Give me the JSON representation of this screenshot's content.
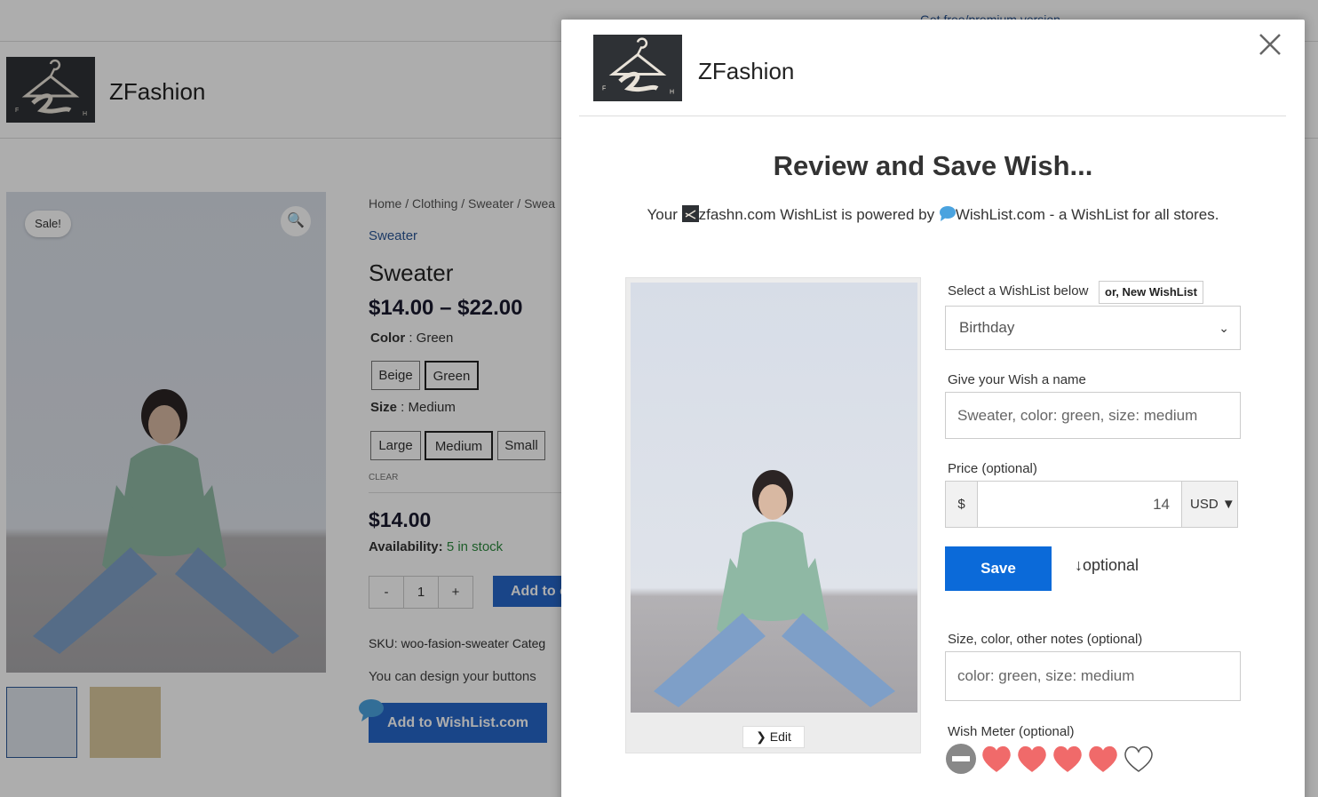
{
  "colors": {
    "accent": "#2666c9",
    "save": "#0b6ad9",
    "heart": "#f06a6a",
    "link": "#2b5797",
    "stock": "#2d8a3e"
  },
  "store": {
    "promo_link": "Get free/premium version",
    "site_name": "ZFashion",
    "sale_badge": "Sale!",
    "breadcrumb": "Home / Clothing / Sweater / Swea",
    "category_link": "Sweater",
    "product_title": "Sweater",
    "price_range": "$14.00 – $22.00",
    "color_label": "Color",
    "color_value": " : Green",
    "colors": [
      "Beige",
      "Green"
    ],
    "size_label": "Size",
    "size_value": " : Medium",
    "sizes": [
      "Large",
      "Medium",
      "Small"
    ],
    "clear": "CLEAR",
    "price_now": "$14.00",
    "availability_label": "Availability:",
    "availability_value": "5 in stock",
    "qty_minus": "-",
    "qty_value": "1",
    "qty_plus": "+",
    "add_to_cart": "Add to cart",
    "sku_line": "SKU: woo-fasion-sweater   Categ",
    "design_note": "You can design your buttons",
    "wishlist_button": "Add to WishList.com",
    "logo_letters": [
      "F",
      "H"
    ]
  },
  "modal": {
    "store_name": "ZFashion",
    "heading": "Review and Save Wish...",
    "powered_prefix": "Your ",
    "powered_store": "zfashn.com WishList is powered by ",
    "powered_site": "WishList.com - a WishList for all stores.",
    "edit_label": "Edit",
    "select_label": "Select a WishList below",
    "new_wishlist": "or, New WishList",
    "selected_wishlist": "Birthday",
    "name_label": "Give your Wish a name",
    "name_value": "Sweater, color: green, size: medium",
    "price_label": "Price (optional)",
    "currency_symbol": "$",
    "price_value": "14",
    "currency": "USD",
    "save_label": "Save",
    "optional_note": "optional",
    "notes_label": "Size, color, other notes (optional)",
    "notes_value": "color: green, size: medium",
    "meter_label": "Wish Meter (optional)",
    "wish_meter": {
      "filled": 4,
      "total": 5
    }
  }
}
